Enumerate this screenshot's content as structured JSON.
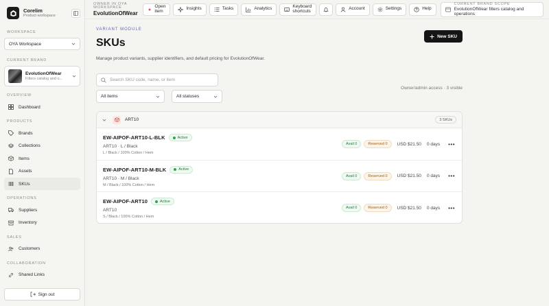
{
  "sidebar": {
    "app_name": "Corelim",
    "app_sub": "Product workspace",
    "workspace_label": "WORKSPACE",
    "workspace_value": "OYA Workspace",
    "current_brand_label": "CURRENT BRAND",
    "brand_name": "EvolutionOfWear",
    "brand_desc": "Filters catalog and o...",
    "overview_label": "OVERVIEW",
    "dashboard": "Dashboard",
    "products_label": "PRODUCTS",
    "brands": "Brands",
    "collections": "Collections",
    "items": "Items",
    "assets": "Assets",
    "skus": "SKUs",
    "operations_label": "OPERATIONS",
    "suppliers": "Suppliers",
    "inventory": "Inventory",
    "sales_label": "SALES",
    "customers": "Customers",
    "collaboration_label": "COLLABORATION",
    "shared_links": "Shared Links",
    "sign_out": "Sign out"
  },
  "topbar": {
    "owner_label": "OWNER IN OYA WORKSPACE",
    "owner_name": "EvolutionOfWear",
    "open_item_line1": "Open",
    "open_item_line2": "item",
    "insights": "Insights",
    "tasks": "Tasks",
    "analytics": "Analytics",
    "keyboard_line1": "Keyboard",
    "keyboard_line2": "shortcuts",
    "account": "Account",
    "settings": "Settings",
    "help": "Help",
    "scope_label": "CURRENT BRAND SCOPE",
    "scope_text": "EvolutionOfWear filters catalog and operations"
  },
  "main": {
    "eyebrow": "VARIANT MODULE",
    "title": "SKUs",
    "description": "Manage product variants, supplier identifiers, and default pricing for EvolutionOfWear.",
    "new_button": "New SKU",
    "search_placeholder": "Search SKU code, name, or item",
    "filter_items": "All items",
    "filter_statuses": "All statuses",
    "access_text": "Owner/admin access · 3 visible",
    "group_name": "ART10",
    "group_count": "3 SKUs"
  },
  "rows": [
    {
      "code": "EW-AIPOF-ART10-L-BLK",
      "status": "Active",
      "variant": "ART10 · L / Black",
      "attrs": "L / Black / 100% Cotton / Hem",
      "avail": "Avail 0",
      "reserved": "Reserved 0",
      "price": "USD $21.50",
      "days": "0 days"
    },
    {
      "code": "EW-AIPOF-ART10-M-BLK",
      "status": "Active",
      "variant": "ART10 · M / Black",
      "attrs": "M / Black / 100% Cotton / Hem",
      "avail": "Avail 0",
      "reserved": "Reserved 0",
      "price": "USD $21.50",
      "days": "0 days"
    },
    {
      "code": "EW-AIPOF-ART10",
      "status": "Active",
      "variant": "ART10",
      "attrs": "S / Black / 100% Cotton / Hem",
      "avail": "Avail 0",
      "reserved": "Reserved 0",
      "price": "USD $21.50",
      "days": "0 days"
    }
  ],
  "more_glyph": "•••",
  "colors": {
    "accent": "#5a64c8",
    "primary_button": "#151515",
    "active_status": "#2fa350",
    "reserved": "#a15e10"
  }
}
